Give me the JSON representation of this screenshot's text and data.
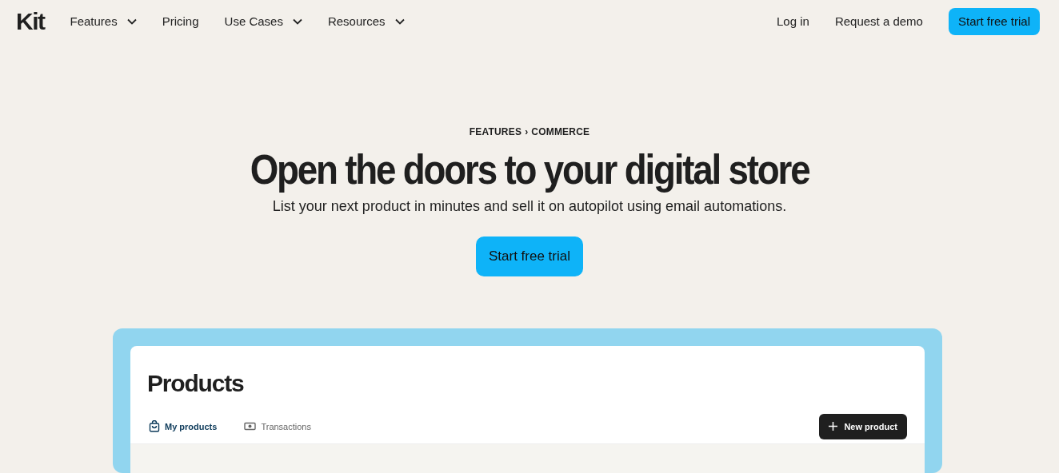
{
  "logo": "Kit",
  "nav": [
    {
      "label": "Features",
      "dropdown": true
    },
    {
      "label": "Pricing",
      "dropdown": false
    },
    {
      "label": "Use Cases",
      "dropdown": true
    },
    {
      "label": "Resources",
      "dropdown": true
    }
  ],
  "actions": {
    "login": "Log in",
    "demo": "Request a demo",
    "trial": "Start free trial"
  },
  "hero": {
    "breadcrumb": [
      "FEATURES",
      "›",
      "COMMERCE"
    ],
    "title": "Open the doors to your digital store",
    "subtitle": "List your next product in minutes and sell it on autopilot using email automations.",
    "cta": "Start free trial"
  },
  "app": {
    "title": "Products",
    "tabs": [
      {
        "label": "My products",
        "kind": "bag",
        "selected": true
      },
      {
        "label": "Transactions",
        "kind": "cash",
        "selected": false
      }
    ],
    "new_button": "New product"
  }
}
